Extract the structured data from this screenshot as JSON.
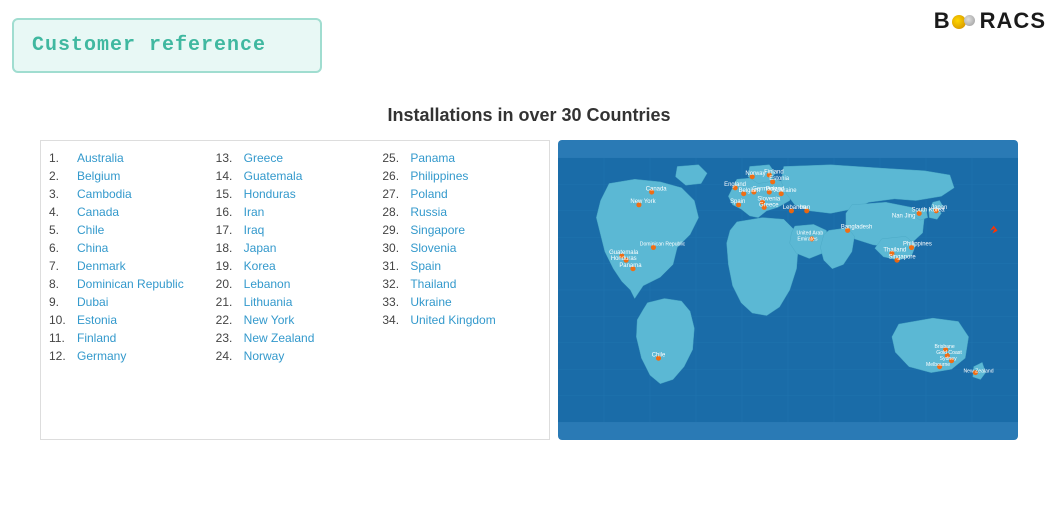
{
  "logo": {
    "text_before": "B",
    "text_after": "RACS"
  },
  "header": {
    "customer_ref_label": "Customer reference"
  },
  "section": {
    "title": "Installations in over 30 Countries"
  },
  "countries": {
    "col1": [
      {
        "num": "1.",
        "name": "Australia"
      },
      {
        "num": "2.",
        "name": "Belgium"
      },
      {
        "num": "3.",
        "name": "Cambodia"
      },
      {
        "num": "4.",
        "name": "Canada"
      },
      {
        "num": "5.",
        "name": "Chile"
      },
      {
        "num": "6.",
        "name": "China"
      },
      {
        "num": "7.",
        "name": "Denmark"
      },
      {
        "num": "8.",
        "name": "Dominican Republic"
      },
      {
        "num": "9.",
        "name": "Dubai"
      },
      {
        "num": "10.",
        "name": "Estonia"
      },
      {
        "num": "11.",
        "name": "Finland"
      },
      {
        "num": "12.",
        "name": "Germany"
      }
    ],
    "col2": [
      {
        "num": "13.",
        "name": "Greece"
      },
      {
        "num": "14.",
        "name": "Guatemala"
      },
      {
        "num": "15.",
        "name": "Honduras"
      },
      {
        "num": "16.",
        "name": "Iran"
      },
      {
        "num": "17.",
        "name": "Iraq"
      },
      {
        "num": "18.",
        "name": "Japan"
      },
      {
        "num": "19.",
        "name": "Korea"
      },
      {
        "num": "20.",
        "name": "Lebanon"
      },
      {
        "num": "21.",
        "name": "Lithuania"
      },
      {
        "num": "22.",
        "name": "New York"
      },
      {
        "num": "23.",
        "name": "New Zealand"
      },
      {
        "num": "24.",
        "name": "Norway"
      }
    ],
    "col3": [
      {
        "num": "25.",
        "name": "Panama"
      },
      {
        "num": "26.",
        "name": "Philippines"
      },
      {
        "num": "27.",
        "name": "Poland"
      },
      {
        "num": "28.",
        "name": "Russia"
      },
      {
        "num": "29.",
        "name": "Singapore"
      },
      {
        "num": "30.",
        "name": "Slovenia"
      },
      {
        "num": "31.",
        "name": "Spain"
      },
      {
        "num": "32.",
        "name": "Thailand"
      },
      {
        "num": "33.",
        "name": "Ukraine"
      },
      {
        "num": "34.",
        "name": "United Kingdom"
      }
    ]
  }
}
